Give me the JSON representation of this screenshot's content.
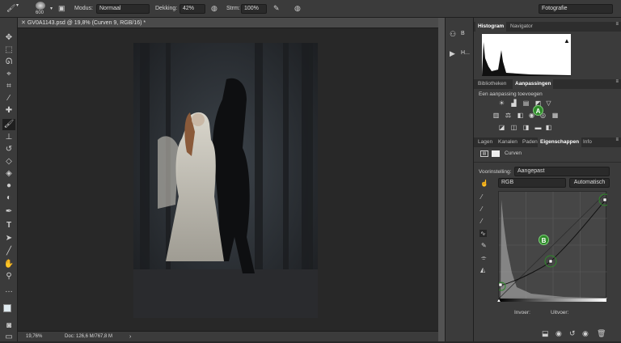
{
  "options_bar": {
    "brush_size": "600",
    "mode_label": "Modus:",
    "mode_value": "Normaal",
    "opacity_label": "Dekking:",
    "opacity_value": "42%",
    "flow_label": "Strm:",
    "flow_value": "100%",
    "workspace": "Fotografie"
  },
  "document": {
    "tab_title": "GV0A1143.psd @ 19,8% (Curven 9, RGB/16) *",
    "zoom": "19,76%",
    "doc_size": "Doc: 126,6 M/767,8 M"
  },
  "dock": {
    "item1_label": "B",
    "item2_label": "H..."
  },
  "histogram_panel": {
    "tabs": [
      "Histogram",
      "Navigator"
    ]
  },
  "adjustments_panel": {
    "tabs": [
      "Bibliotheken",
      "Aanpassingen"
    ],
    "heading": "Een aanpassing toevoegen",
    "callout": "A"
  },
  "properties_panel": {
    "tabs": [
      "Lagen",
      "Kanalen",
      "Paden",
      "Eigenschappen",
      "Info"
    ],
    "layer_type": "Curven",
    "preset_label": "Voorinstelling:",
    "preset_value": "Aangepast",
    "channel_value": "RGB",
    "auto_button": "Automatisch",
    "callout": "B",
    "input_label": "Invoer:",
    "output_label": "Uitvoer:"
  },
  "colors": {
    "accent_green": "#2f8a2a",
    "panel_bg": "#3b3b3b"
  }
}
